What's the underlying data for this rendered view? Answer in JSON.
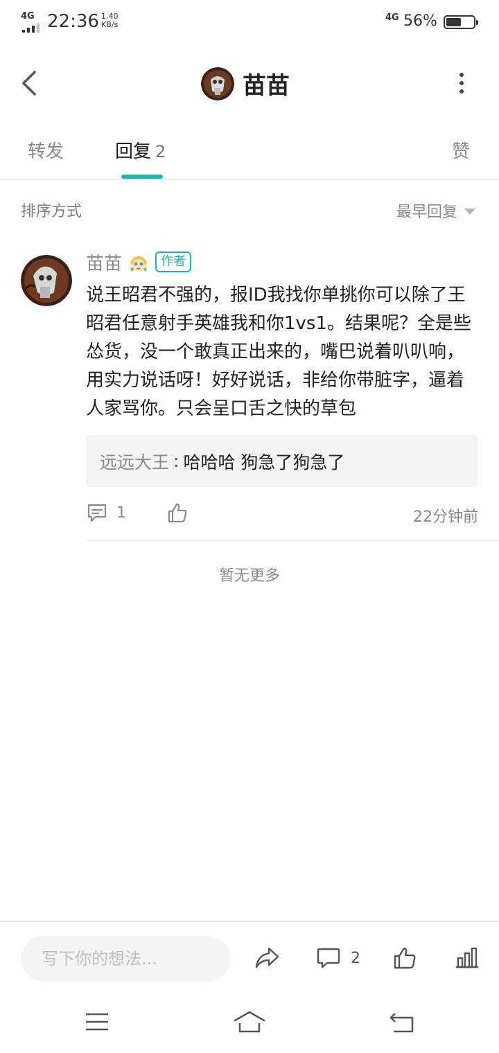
{
  "status_bar": {
    "network": "4G",
    "time": "22:36",
    "speed_value": "1.40",
    "speed_unit": "KB/s",
    "right_network": "4G",
    "battery_percent_label": "56%",
    "battery_level": 0.56
  },
  "header": {
    "title": "苗苗",
    "avatar_icon": "user-avatar-icon"
  },
  "tabs": [
    {
      "label": "转发"
    },
    {
      "label": "回复",
      "count": "2"
    },
    {
      "label": "赞"
    }
  ],
  "sort": {
    "label": "排序方式",
    "selected": "最早回复"
  },
  "comment": {
    "author": "苗苗",
    "author_badge": "作者",
    "text": "说王昭君不强的，报ID我找你单挑你可以除了王昭君任意射手英雄我和你1vs1。结果呢？全是些怂货，没一个敢真正出来的，嘴巴说着叭叭响，用实力说话呀！好好说话，非给你带脏字，逼着人家骂你。只会呈口舌之快的草包",
    "reply": {
      "author": "远远大王",
      "separator": ":",
      "text": "哈哈哈 狗急了狗急了"
    },
    "reply_count": "1",
    "time": "22分钟前"
  },
  "no_more": "暂无更多",
  "bottom_bar": {
    "input_placeholder": "写下你的想法...",
    "comment_count": "2"
  },
  "colors": {
    "accent": "#1bb8b3",
    "text_primary": "#222222",
    "text_secondary": "#8a8a8a",
    "reply_bg": "#f4f4f4"
  }
}
